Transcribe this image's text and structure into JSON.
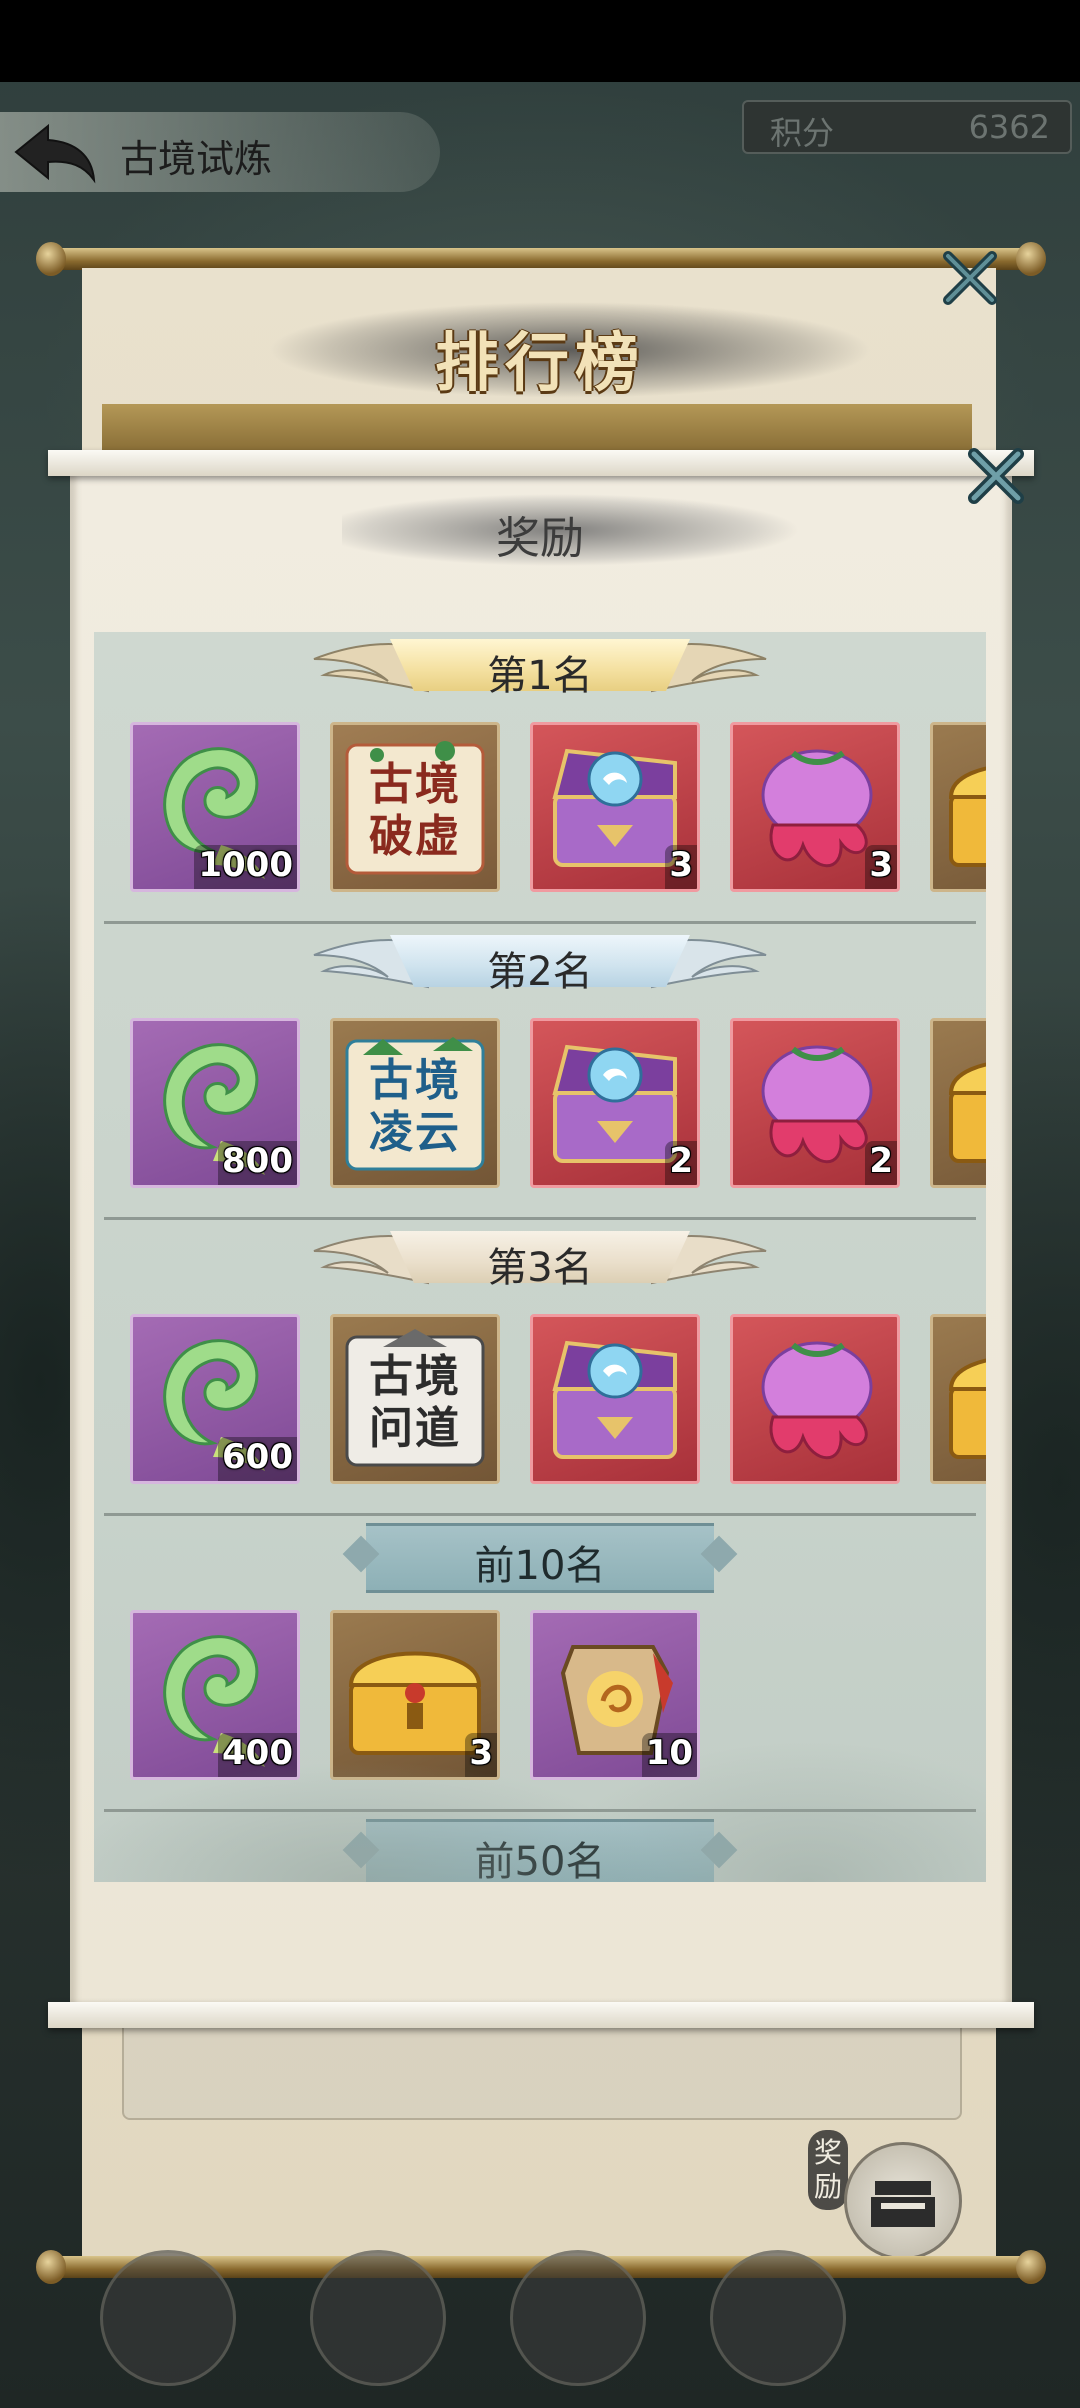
{
  "header": {
    "title": "古境试炼",
    "score_label": "积分",
    "score_value": "6362"
  },
  "ranking_panel": {
    "title": "排行榜",
    "reward_button_label": "奖励"
  },
  "reward_panel": {
    "title": "奖励",
    "tiers": [
      {
        "label": "第1名",
        "style": "gold",
        "items": [
          {
            "icon": "jade-ornament-icon",
            "count": "1000"
          },
          {
            "icon": "title-gujing-poxu-icon",
            "text": "古境破虚",
            "count": ""
          },
          {
            "icon": "treasure-chest-icon",
            "count": "3"
          },
          {
            "icon": "gift-pouch-icon",
            "count": "3"
          },
          {
            "icon": "golden-chest-icon",
            "count": ""
          }
        ]
      },
      {
        "label": "第2名",
        "style": "silver",
        "items": [
          {
            "icon": "jade-ornament-icon",
            "count": "800"
          },
          {
            "icon": "title-gujing-lingyun-icon",
            "text": "古境凌云",
            "count": ""
          },
          {
            "icon": "treasure-chest-icon",
            "count": "2"
          },
          {
            "icon": "gift-pouch-icon",
            "count": "2"
          },
          {
            "icon": "golden-chest-icon",
            "count": ""
          }
        ]
      },
      {
        "label": "第3名",
        "style": "bronze",
        "items": [
          {
            "icon": "jade-ornament-icon",
            "count": "600"
          },
          {
            "icon": "title-gujing-wendao-icon",
            "text": "古境问道",
            "count": ""
          },
          {
            "icon": "treasure-chest-icon",
            "count": ""
          },
          {
            "icon": "gift-pouch-icon",
            "count": ""
          },
          {
            "icon": "golden-chest-icon",
            "count": ""
          }
        ]
      },
      {
        "label": "前10名",
        "style": "plain",
        "items": [
          {
            "icon": "jade-ornament-icon",
            "count": "400"
          },
          {
            "icon": "golden-chest-icon",
            "count": "3"
          },
          {
            "icon": "dragon-token-icon",
            "count": "10"
          }
        ]
      },
      {
        "label": "前50名",
        "style": "plain",
        "items": []
      }
    ]
  },
  "colors": {
    "panel_paper": "#f1ece0",
    "list_background": "#cfd8d0",
    "purple_slot": "#7f4a96",
    "red_slot": "#a8313a",
    "brown_slot": "#735636"
  }
}
